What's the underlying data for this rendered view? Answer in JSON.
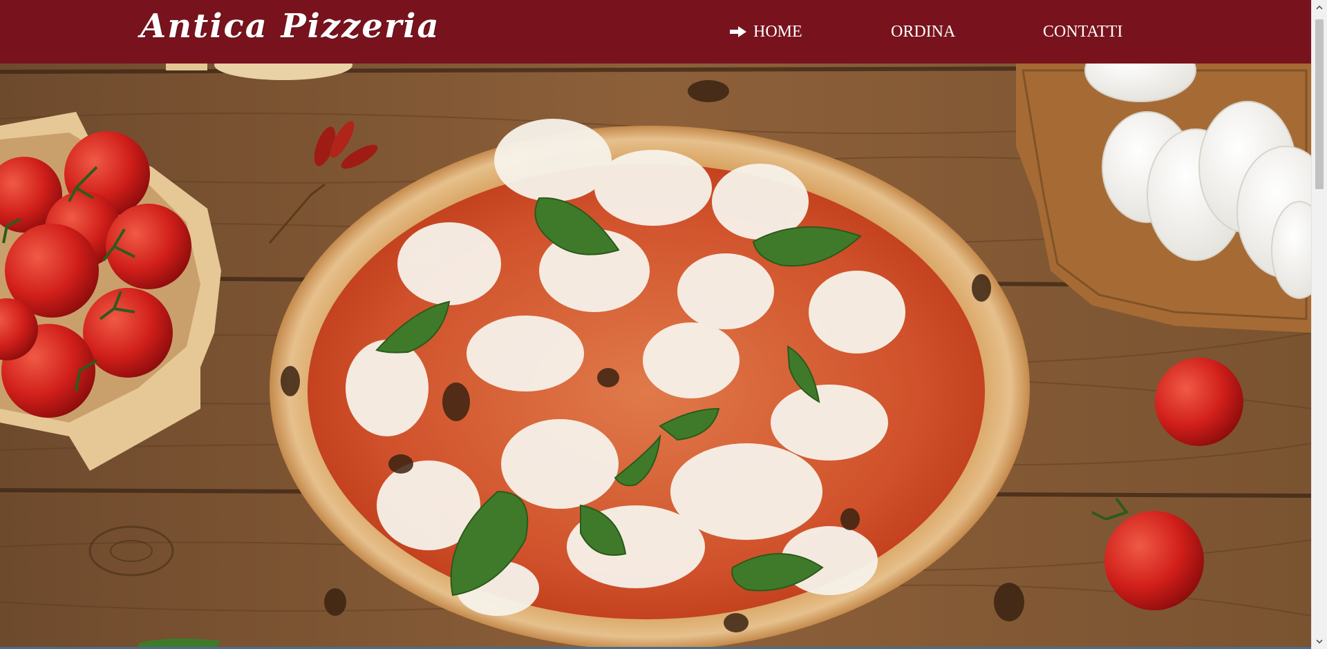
{
  "header": {
    "brand": "Antica Pizzeria",
    "nav": [
      {
        "label": "HOME",
        "active": true,
        "icon": "arrow-right-icon"
      },
      {
        "label": "ORDINA",
        "active": false
      },
      {
        "label": "CONTATTI",
        "active": false
      }
    ]
  },
  "hero": {
    "image": "pizza-margherita-on-wooden-table"
  },
  "colors": {
    "header_bg": "#78131d",
    "nav_text": "#ffffff",
    "wood": "#8a5d38"
  }
}
